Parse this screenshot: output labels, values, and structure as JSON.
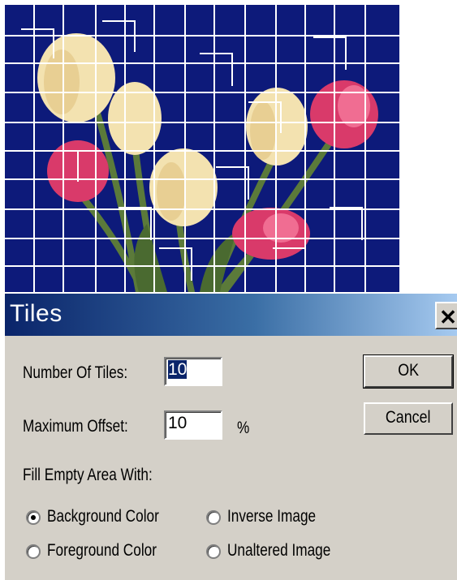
{
  "dialog": {
    "title": "Tiles",
    "close_icon": "close-icon",
    "number_of_tiles_label": "Number Of Tiles:",
    "number_of_tiles_value": "10",
    "maximum_offset_label": "Maximum Offset:",
    "maximum_offset_value": "10",
    "offset_unit": "%",
    "fill_group_label": "Fill Empty Area With:",
    "options": {
      "background_color": "Background Color",
      "foreground_color": "Foreground Color",
      "inverse_image": "Inverse Image",
      "unaltered_image": "Unaltered Image"
    },
    "selected_option": "Background Color",
    "ok_label": "OK",
    "cancel_label": "Cancel"
  },
  "preview": {
    "subject": "tulips",
    "background_color": "#0d1a7a",
    "tile_line_color": "#ffffff"
  }
}
